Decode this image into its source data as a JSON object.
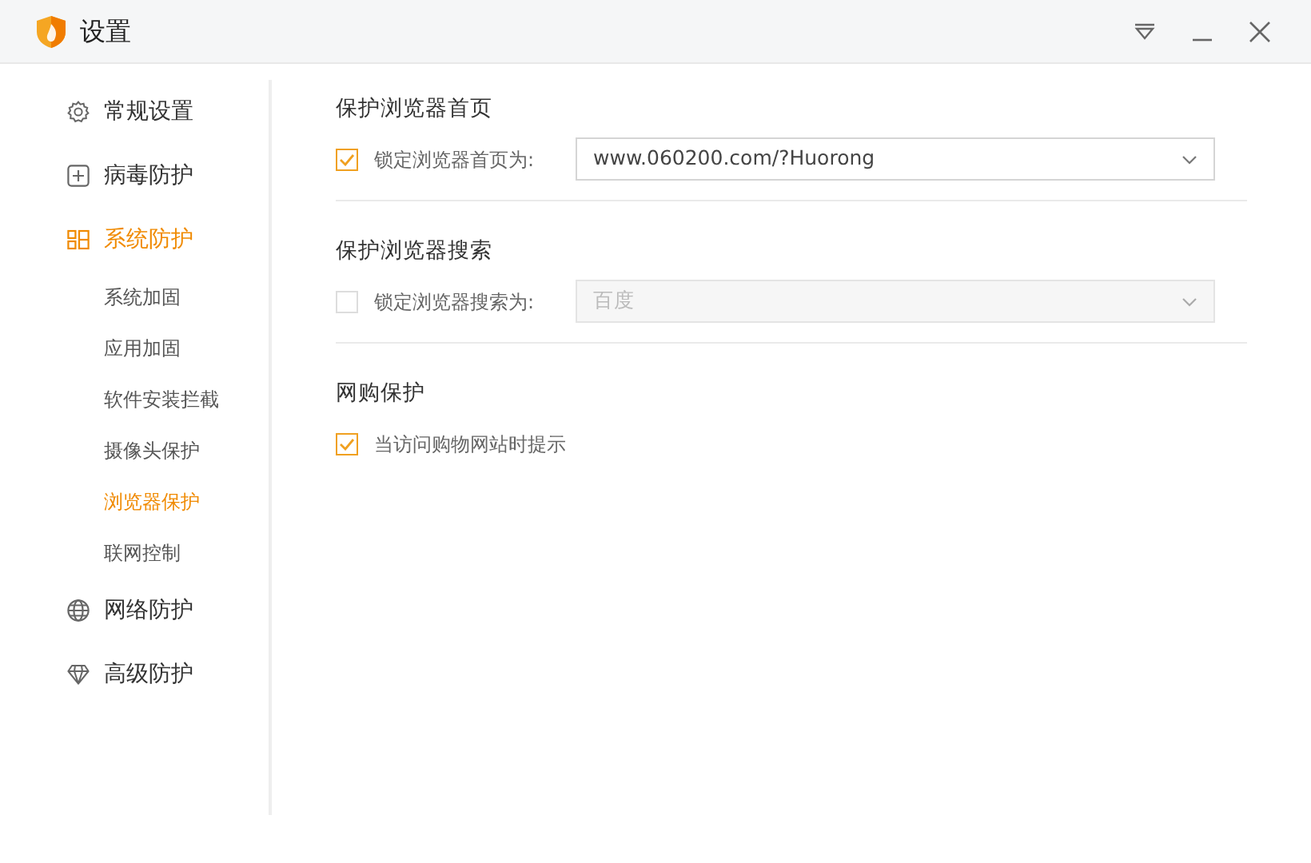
{
  "window": {
    "title": "设置"
  },
  "sidebar": {
    "items": [
      {
        "label": "常规设置",
        "selected": false
      },
      {
        "label": "病毒防护",
        "selected": false
      },
      {
        "label": "系统防护",
        "selected": true,
        "children": [
          {
            "label": "系统加固",
            "selected": false
          },
          {
            "label": "应用加固",
            "selected": false
          },
          {
            "label": "软件安装拦截",
            "selected": false
          },
          {
            "label": "摄像头保护",
            "selected": false
          },
          {
            "label": "浏览器保护",
            "selected": true
          },
          {
            "label": "联网控制",
            "selected": false
          }
        ]
      },
      {
        "label": "网络防护",
        "selected": false
      },
      {
        "label": "高级防护",
        "selected": false
      }
    ]
  },
  "sections": [
    {
      "title": "保护浏览器首页",
      "option": {
        "label": "锁定浏览器首页为:",
        "checked": true,
        "select": {
          "value": "www.060200.com/?Huorong",
          "disabled": false
        }
      }
    },
    {
      "title": "保护浏览器搜索",
      "option": {
        "label": "锁定浏览器搜索为:",
        "checked": false,
        "select": {
          "value": "百度",
          "disabled": true
        }
      }
    },
    {
      "title": "网购保护",
      "option": {
        "label": "当访问购物网站时提示",
        "checked": true
      }
    }
  ]
}
